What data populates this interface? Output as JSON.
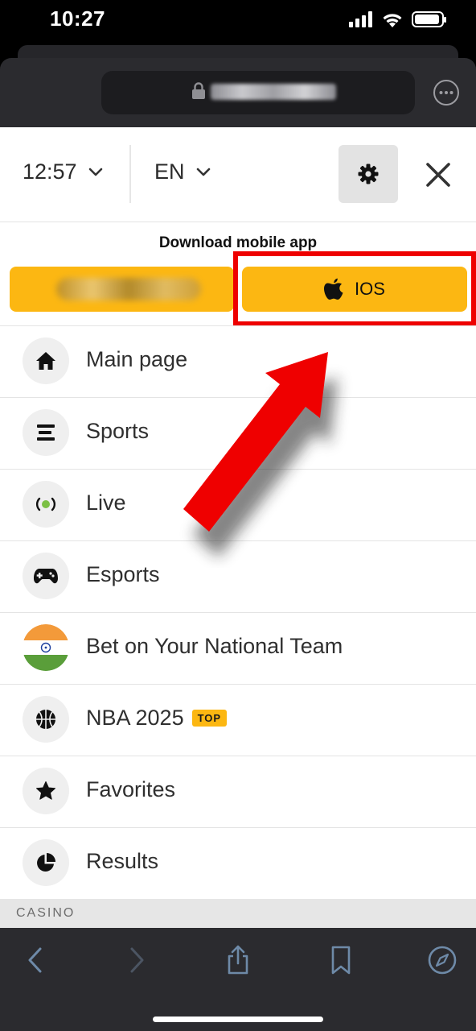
{
  "status_bar": {
    "time": "10:27"
  },
  "header": {
    "time_value": "12:57",
    "language": "EN"
  },
  "download": {
    "title": "Download mobile app",
    "ios_label": "IOS"
  },
  "menu": {
    "items": [
      {
        "label": "Main page",
        "icon": "home-icon"
      },
      {
        "label": "Sports",
        "icon": "sports-icon"
      },
      {
        "label": "Live",
        "icon": "live-icon"
      },
      {
        "label": "Esports",
        "icon": "gamepad-icon"
      },
      {
        "label": "Bet on Your National Team",
        "icon": "india-flag-icon"
      },
      {
        "label": "NBA 2025",
        "icon": "basketball-icon",
        "badge": "TOP"
      },
      {
        "label": "Favorites",
        "icon": "star-icon"
      },
      {
        "label": "Results",
        "icon": "pie-chart-icon"
      }
    ]
  },
  "section": {
    "casino_label": "CASINO"
  },
  "colors": {
    "accent_yellow": "#fcb712",
    "highlight_red": "#ee0000",
    "live_green": "#7bc043"
  }
}
